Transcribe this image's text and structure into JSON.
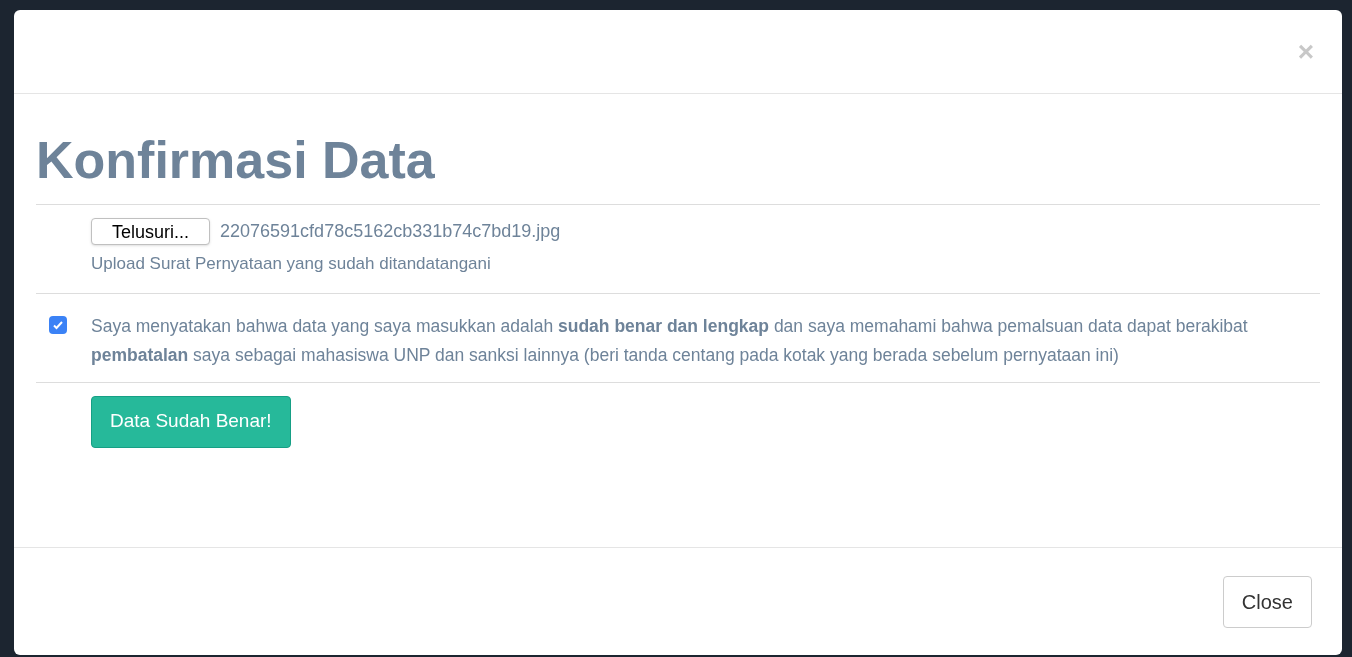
{
  "modal": {
    "close_symbol": "×",
    "title": "Konfirmasi Data",
    "upload": {
      "button": "Telusuri...",
      "file_name": "22076591cfd78c5162cb331b74c7bd19.jpg",
      "help": "Upload Surat Pernyataan yang sudah ditandatangani"
    },
    "agreement": {
      "checked": true,
      "text": "Saya menyatakan bahwa data yang saya masukkan adalah **sudah benar dan lengkap** dan saya memahami bahwa pemalsuan data dapat berakibat **pembatalan** saya sebagai mahasiswa UNP dan sanksi lainnya (beri tanda centang pada kotak yang berada sebelum pernyataan ini)"
    },
    "submit": "Data Sudah Benar!",
    "footer_button": "Close"
  }
}
